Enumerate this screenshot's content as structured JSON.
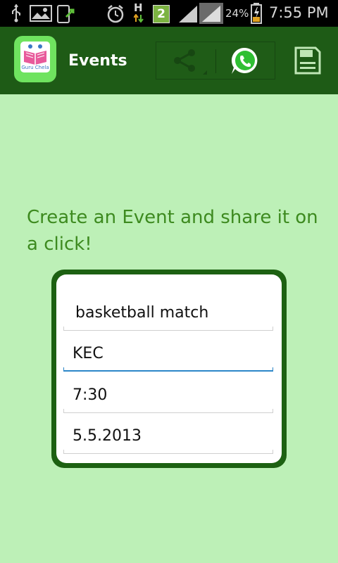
{
  "status_bar": {
    "signal_label": "H",
    "notification_count": "2",
    "battery_percent": "24%",
    "time": "7:55 PM",
    "icons": [
      "usb-icon",
      "gallery-icon",
      "upload-icon",
      "alarm-icon",
      "network-h-icon",
      "notification-badge",
      "signal-icon",
      "signal-icon",
      "battery-icon"
    ]
  },
  "action_bar": {
    "title": "Events",
    "logo_caption": "Guru Chela",
    "actions": [
      "share-icon",
      "whatsapp-icon",
      "save-icon"
    ]
  },
  "main": {
    "headline": "Create an Event and share it on a click!",
    "form": {
      "event_name": "basketball match",
      "venue": "KEC",
      "time": "7:30",
      "date": "5.5.2013"
    }
  },
  "colors": {
    "background": "#bdf0b7",
    "action_bar": "#1e5b16",
    "headline": "#3d8a1f",
    "card_border": "#1d6112",
    "focus_underline": "#2b86c8"
  }
}
